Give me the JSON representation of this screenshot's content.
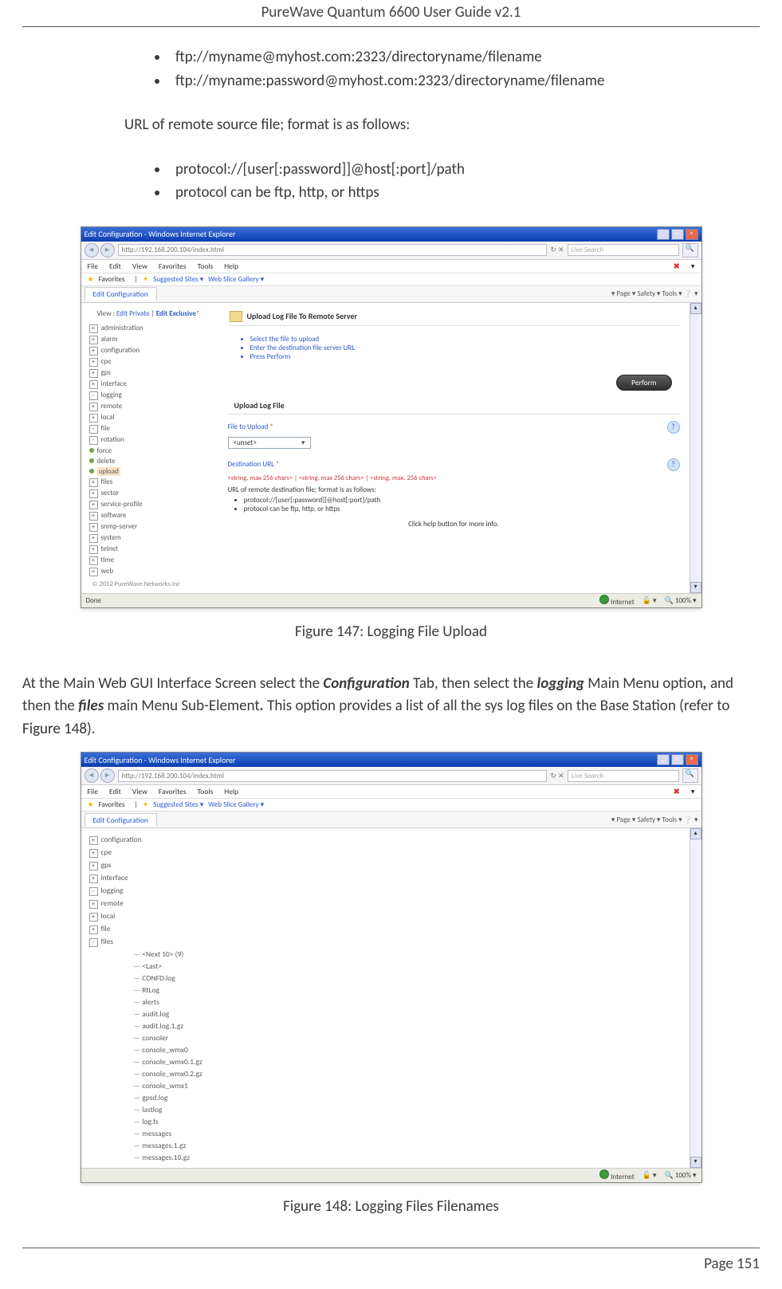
{
  "header": {
    "title": "PureWave Quantum 6600 User Guide v2.1"
  },
  "intro_bullets": [
    "ftp://myname@myhost.com:2323/directoryname/filename",
    "ftp://myname:password@myhost.com:2323/directoryname/filename"
  ],
  "format_intro": "URL of remote source file; format is as follows:",
  "format_bullets": [
    "protocol://[user[:password]]@host[:port]/path",
    "protocol can be ftp, http, or https"
  ],
  "figure147": {
    "caption": "Figure 147: Logging File Upload",
    "window_title": "Edit Configuration - Windows Internet Explorer",
    "address": "http://192.168.200.104/index.html",
    "search_placeholder": "Live Search",
    "menubar": [
      "File",
      "Edit",
      "View",
      "Favorites",
      "Tools",
      "Help"
    ],
    "favbar_label": "Favorites",
    "favbar_links": [
      "Suggested Sites ▾",
      "Web Slice Gallery ▾"
    ],
    "tab_label": "Edit Configuration",
    "toolbar_right": "▾  Page ▾  Safety ▾  Tools ▾  ❔ ▾",
    "view_row": {
      "view": "View :",
      "priv": "Edit Private |",
      "excl": "Edit Exclusive",
      "star": "*"
    },
    "tree": [
      {
        "pm": "+",
        "label": "administration"
      },
      {
        "pm": "+",
        "label": "alarm"
      },
      {
        "pm": "+",
        "label": "configuration"
      },
      {
        "pm": "+",
        "label": "cpe"
      },
      {
        "pm": "+",
        "label": "gps"
      },
      {
        "pm": "+",
        "label": "interface"
      },
      {
        "pm": "-",
        "label": "logging",
        "children": [
          {
            "pm": "+",
            "label": "remote",
            "cls": "sub1"
          },
          {
            "pm": "+",
            "label": "local",
            "cls": "sub1"
          },
          {
            "pm": "-",
            "label": "file",
            "cls": "sub1",
            "children": [
              {
                "pm": "-",
                "label": "rotation",
                "cls": "sub2",
                "children": [
                  {
                    "dot": true,
                    "label": "force",
                    "cls": "sub3"
                  }
                ]
              },
              {
                "dot": true,
                "label": "delete",
                "cls": "sub2"
              },
              {
                "dot": true,
                "label": "upload",
                "cls": "sub2",
                "hl": true
              }
            ]
          },
          {
            "pm": "+",
            "label": "files",
            "cls": "sub1"
          }
        ]
      },
      {
        "pm": "+",
        "label": "sector"
      },
      {
        "pm": "+",
        "label": "service-profile"
      },
      {
        "pm": "+",
        "label": "software"
      },
      {
        "pm": "+",
        "label": "snmp-server"
      },
      {
        "pm": "+",
        "label": "system"
      },
      {
        "pm": "+",
        "label": "telnet"
      },
      {
        "pm": "+",
        "label": "time"
      },
      {
        "pm": "+",
        "label": "web"
      }
    ],
    "panel1_title": "Upload Log File To Remote Server",
    "panel1_instr": [
      "Select the file to upload",
      "Enter the destination file server URL",
      "Press Perform"
    ],
    "perform_label": "Perform",
    "panel2_title": "Upload Log File",
    "file_label": "File to Upload",
    "file_value": "<unset>",
    "dest_label": "Destination URL",
    "dest_hint": "<string, max 256 chars> | <string, max 256 chars> | <string, max. 256 chars>",
    "url_desc_line": "URL of remote destination file; format is as follows:",
    "url_desc_bullets": [
      "protocol://[user[:password]]@host[:port]/path",
      "protocol can be ftp, http, or https"
    ],
    "click_help": "Click help button for more info.",
    "copyright": "© 2012 PureWave Networks Inc",
    "status_left": "Done",
    "status_net": "Internet",
    "status_zoom": "100%"
  },
  "mid_paragraph": {
    "p1": "At the Main Web GUI Interface Screen select the ",
    "em1": "Configuration",
    "p2": " Tab, then select the ",
    "em2": "logging",
    "p3": " Main Menu option",
    "em3": ",",
    "p4": " and then the ",
    "em4": "files",
    "p5": " main Menu Sub-Element",
    "em5": ".",
    "p6": " This option provides a list of all the sys log files on the Base Station (refer to ",
    "figref": "Figure 148",
    "p7": ")."
  },
  "figure148": {
    "caption": "Figure 148: Logging Files Filenames",
    "window_title": "Edit Configuration - Windows Internet Explorer",
    "address": "http://192.168.200.104/index.html",
    "search_placeholder": "Live Search",
    "menubar": [
      "File",
      "Edit",
      "View",
      "Favorites",
      "Tools",
      "Help"
    ],
    "favbar_label": "Favorites",
    "favbar_links": [
      "Suggested Sites ▾",
      "Web Slice Gallery ▾"
    ],
    "tab_label": "Edit Configuration",
    "toolbar_right": "▾  Page ▾  Safety ▾  Tools ▾  ❔ ▾",
    "tree_top": [
      {
        "pm": "+",
        "label": "configuration"
      },
      {
        "pm": "+",
        "label": "cpe"
      },
      {
        "pm": "+",
        "label": "gps"
      },
      {
        "pm": "+",
        "label": "interface"
      },
      {
        "pm": "-",
        "label": "logging"
      },
      {
        "pm": "+",
        "label": "remote",
        "cls": "sub1"
      },
      {
        "pm": "+",
        "label": "local",
        "cls": "sub1"
      },
      {
        "pm": "+",
        "label": "file",
        "cls": "sub1"
      },
      {
        "pm": "-",
        "label": "files",
        "cls": "sub1"
      }
    ],
    "files": [
      "<Next 10> (9)",
      "<Last>",
      "CONFD.log",
      "RtLog",
      "alerts",
      "audit.log",
      "audit.log.1.gz",
      "consoler",
      "console_wmx0",
      "console_wmx0.1.gz",
      "console_wmx0.2.gz",
      "console_wmx1",
      "gpsd.log",
      "lastlog",
      "log.fs",
      "messages",
      "messages.1.gz",
      "messages.10.gz"
    ],
    "status_net": "Internet",
    "status_zoom": "100%"
  },
  "footer": {
    "page": "Page 151"
  }
}
